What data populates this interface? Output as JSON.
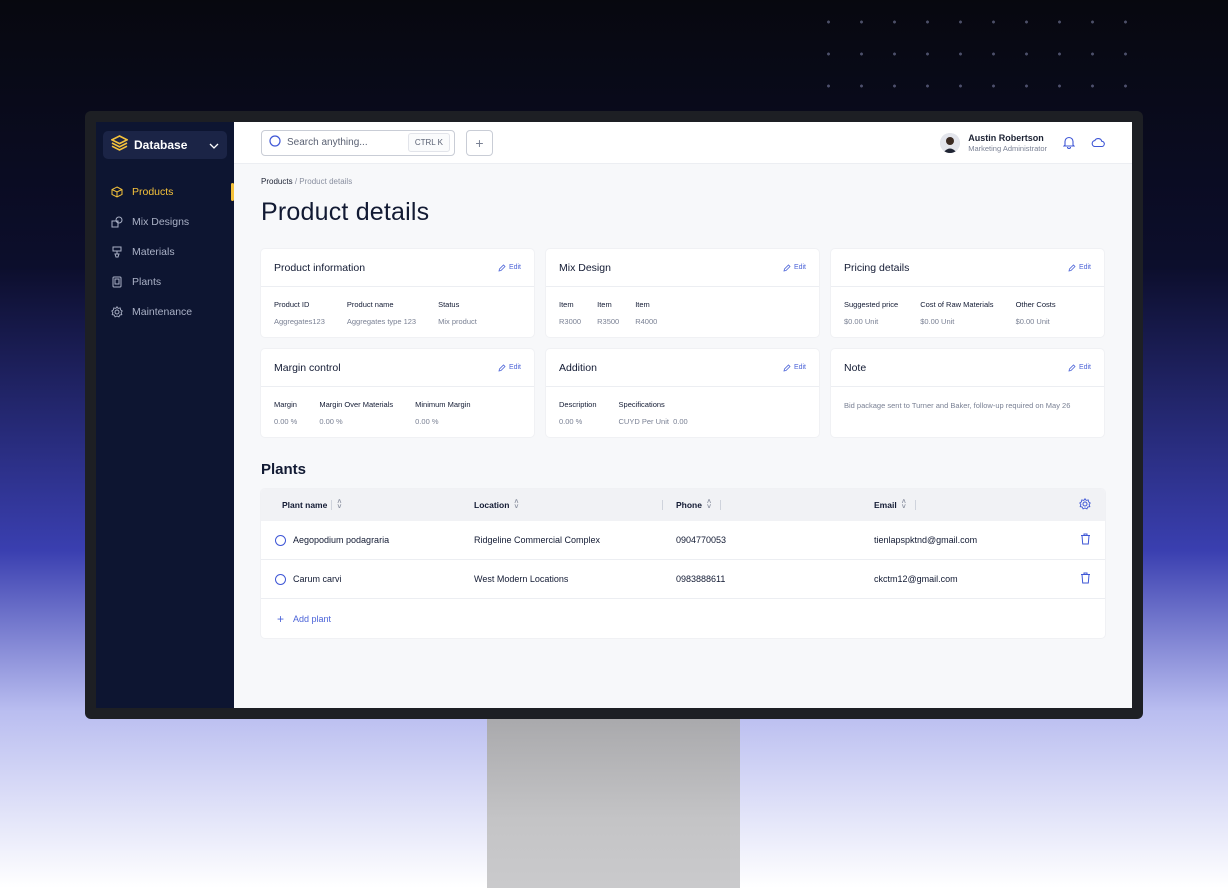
{
  "colors": {
    "accent": "#f5c23b",
    "link": "#4b63d8",
    "sidebar_bg": "#0d1531",
    "text": "#121a33"
  },
  "sidebar": {
    "db_label": "Database",
    "items": [
      {
        "label": "Products",
        "icon": "cube-icon",
        "active": true
      },
      {
        "label": "Mix Designs",
        "icon": "shapes-icon",
        "active": false
      },
      {
        "label": "Materials",
        "icon": "mixer-icon",
        "active": false
      },
      {
        "label": "Plants",
        "icon": "document-icon",
        "active": false
      },
      {
        "label": "Maintenance",
        "icon": "settings-icon",
        "active": false
      }
    ]
  },
  "topbar": {
    "search_placeholder": "Search anything...",
    "shortcut": "CTRL K",
    "user": {
      "name": "Austin Robertson",
      "role": "Marketing Administrator"
    }
  },
  "breadcrumb": {
    "parent": "Products",
    "separator": "/",
    "current": "Product details"
  },
  "page_title": "Product details",
  "cards": {
    "product_info": {
      "title": "Product information",
      "edit": "Edit",
      "fields": [
        {
          "k": "Product ID",
          "v": "Aggregates123"
        },
        {
          "k": "Product name",
          "v": "Aggregates type 123"
        },
        {
          "k": "Status",
          "v": "Mix product"
        }
      ]
    },
    "mix_design": {
      "title": "Mix Design",
      "edit": "Edit",
      "fields": [
        {
          "k": "Item",
          "v": "R3000"
        },
        {
          "k": "Item",
          "v": "R3500"
        },
        {
          "k": "Item",
          "v": "R4000"
        }
      ]
    },
    "pricing": {
      "title": "Pricing details",
      "edit": "Edit",
      "fields": [
        {
          "k": "Suggested price",
          "v": "$0.00 Unit"
        },
        {
          "k": "Cost of Raw Materials",
          "v": "$0.00 Unit"
        },
        {
          "k": "Other Costs",
          "v": "$0.00 Unit"
        }
      ]
    },
    "margin": {
      "title": "Margin control",
      "edit": "Edit",
      "fields": [
        {
          "k": "Margin",
          "v": "0.00 %"
        },
        {
          "k": "Margin Over Materials",
          "v": "0.00 %"
        },
        {
          "k": "Minimum Margin",
          "v": "0.00 %"
        }
      ]
    },
    "addition": {
      "title": "Addition",
      "edit": "Edit",
      "fields": [
        {
          "k": "Description",
          "v": "0.00 %"
        },
        {
          "k": "Specifications",
          "v": "CUYD Per Unit  0.00"
        }
      ]
    },
    "note": {
      "title": "Note",
      "edit": "Edit",
      "text": "Bid package sent to Turner and Baker, follow-up required on May 26"
    }
  },
  "plants": {
    "title": "Plants",
    "columns": [
      "Plant name",
      "Location",
      "Phone",
      "Email"
    ],
    "rows": [
      {
        "name": "Aegopodium podagraria",
        "location": "Ridgeline Commercial Complex",
        "phone": "0904770053",
        "email": "tienlapspktnd@gmail.com"
      },
      {
        "name": "Carum carvi",
        "location": "West Modern Locations",
        "phone": "0983888611",
        "email": "ckctm12@gmail.com"
      }
    ],
    "add_label": "Add plant"
  }
}
